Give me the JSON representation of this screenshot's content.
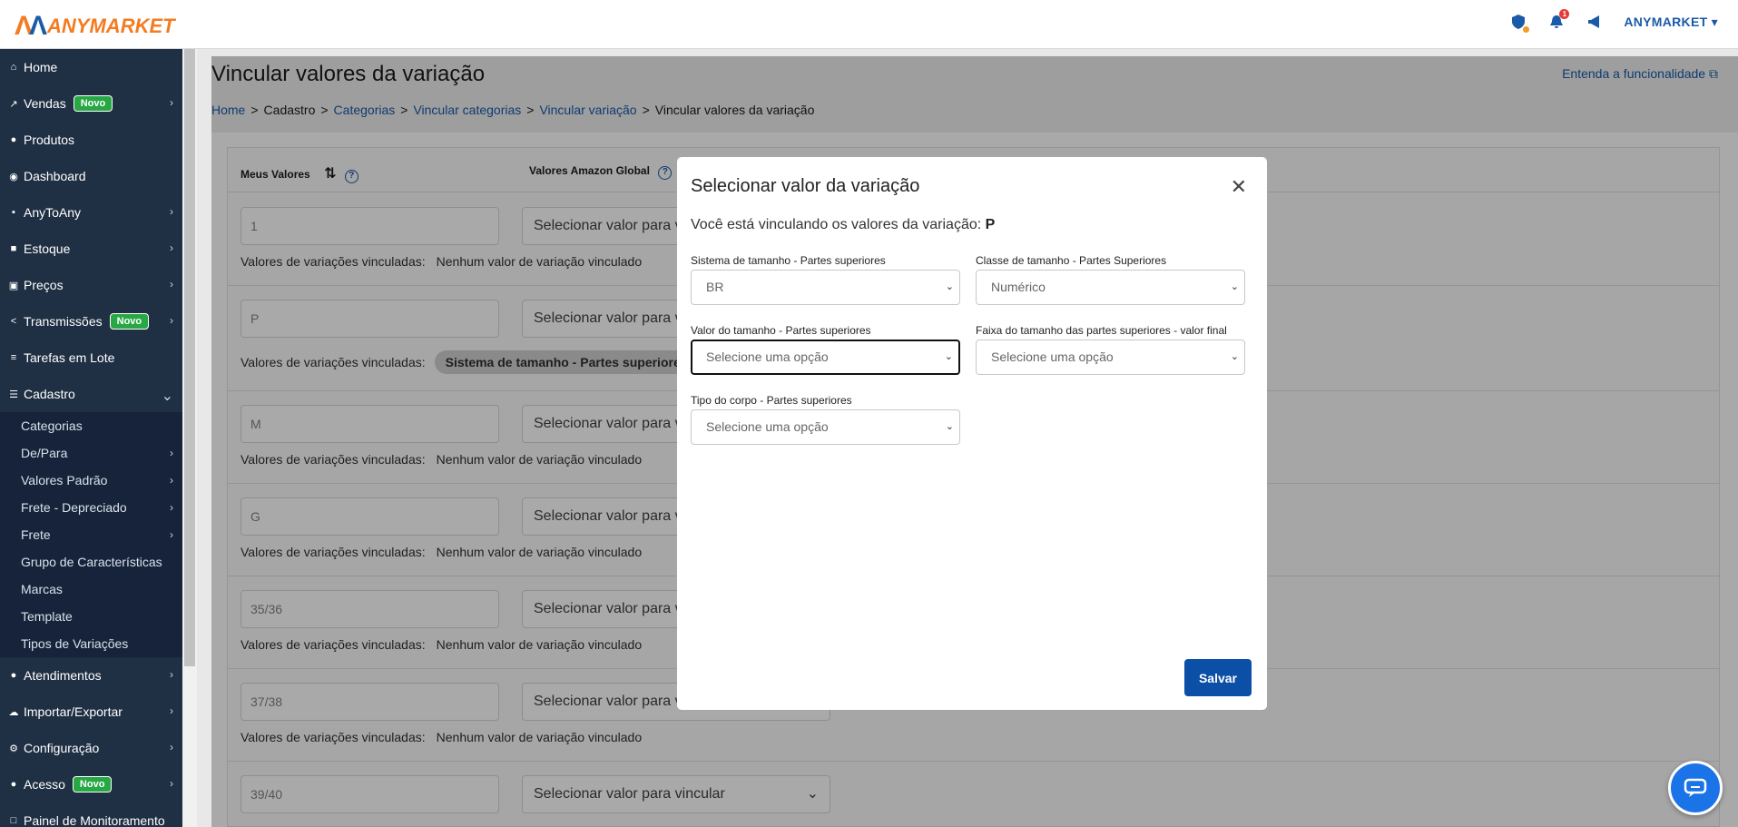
{
  "brand": {
    "mark": "AA",
    "name": "ANYMARKET"
  },
  "topbar": {
    "notification_count": "1",
    "user_name": "ANYMARKET"
  },
  "sidebar": {
    "items": [
      {
        "label": "Home",
        "icon": "home-icon",
        "glyph": "⌂"
      },
      {
        "label": "Vendas",
        "icon": "chart-line-icon",
        "glyph": "↗",
        "badge": "Novo"
      },
      {
        "label": "Produtos",
        "icon": "product-icon",
        "glyph": "●"
      },
      {
        "label": "Dashboard",
        "icon": "dashboard-icon",
        "glyph": "◉"
      },
      {
        "label": "AnyToAny",
        "icon": "bag-icon",
        "glyph": "▪"
      },
      {
        "label": "Estoque",
        "icon": "boxes-icon",
        "glyph": "■"
      },
      {
        "label": "Preços",
        "icon": "money-icon",
        "glyph": "▣"
      },
      {
        "label": "Transmissões",
        "icon": "share-icon",
        "glyph": "<",
        "badge": "Novo"
      },
      {
        "label": "Tarefas em Lote",
        "icon": "list-icon",
        "glyph": "≡"
      },
      {
        "label": "Cadastro",
        "icon": "list-icon",
        "glyph": "☰"
      }
    ],
    "cadastro_sub": [
      {
        "label": "Categorias"
      },
      {
        "label": "De/Para"
      },
      {
        "label": "Valores Padrão"
      },
      {
        "label": "Frete - Depreciado"
      },
      {
        "label": "Frete"
      },
      {
        "label": "Grupo de Características"
      },
      {
        "label": "Marcas"
      },
      {
        "label": "Template"
      },
      {
        "label": "Tipos de Variações"
      }
    ],
    "items_after": [
      {
        "label": "Atendimentos",
        "icon": "chat-icon",
        "glyph": "●"
      },
      {
        "label": "Importar/Exportar",
        "icon": "cloud-icon",
        "glyph": "☁"
      },
      {
        "label": "Configuração",
        "icon": "gear-icon",
        "glyph": "⚙"
      },
      {
        "label": "Acesso",
        "icon": "users-icon",
        "glyph": "●",
        "badge": "Novo"
      },
      {
        "label": "Painel de Monitoramento",
        "icon": "monitor-icon",
        "glyph": "□"
      }
    ]
  },
  "page": {
    "title": "Vincular valores da variação",
    "help_link": "Entenda a funcionalidade",
    "breadcrumb": [
      "Home",
      "Cadastro",
      "Categorias",
      "Vincular categorias",
      "Vincular variação",
      "Vincular valores da variação"
    ],
    "col_meus_valores": "Meus Valores",
    "col_amazon": "Valores Amazon Global",
    "linked_label": "Valores de variações vinculadas:",
    "select_placeholder": "Selecionar valor para vincular",
    "rows": [
      {
        "value": "1",
        "linked": "Nenhum valor de variação vinculado"
      },
      {
        "value": "P",
        "linked_chip": "Sistema de tamanho - Partes superiores"
      },
      {
        "value": "M",
        "linked": "Nenhum valor de variação vinculado"
      },
      {
        "value": "G",
        "linked": "Nenhum valor de variação vinculado"
      },
      {
        "value": "35/36",
        "linked": "Nenhum valor de variação vinculado"
      },
      {
        "value": "37/38",
        "linked": "Nenhum valor de variação vinculado"
      },
      {
        "value": "39/40"
      }
    ]
  },
  "modal": {
    "title": "Selecionar valor da variação",
    "subtitle_prefix": "Você está vinculando os valores da variação:",
    "subtitle_value": "P",
    "fields": {
      "sistema": {
        "label": "Sistema de tamanho - Partes superiores",
        "value": "BR"
      },
      "classe": {
        "label": "Classe de tamanho - Partes Superiores",
        "value": "Numérico"
      },
      "valor": {
        "label": "Valor do tamanho - Partes superiores",
        "value": "Selecione uma opção"
      },
      "faixa": {
        "label": "Faixa do tamanho das partes superiores - valor final",
        "value": "Selecione uma opção"
      },
      "tipo": {
        "label": "Tipo do corpo - Partes superiores",
        "value": "Selecione uma opção"
      }
    },
    "save_label": "Salvar"
  },
  "colors": {
    "brand_blue": "#0b4fa6",
    "brand_orange": "#f47b20",
    "sidebar_bg": "#1f2f44",
    "novo_green": "#28a745"
  }
}
